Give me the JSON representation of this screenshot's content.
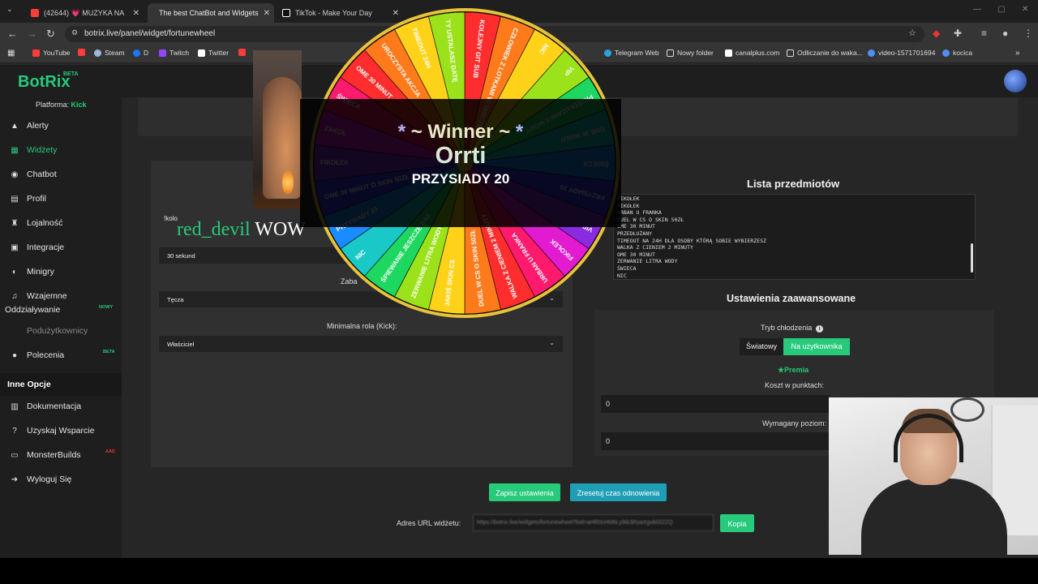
{
  "browser": {
    "tabs": [
      {
        "label": "(42644) 💗 MUZYKA NA",
        "active": false,
        "color": "#ff3b3b"
      },
      {
        "label": "The best ChatBot and Widgets",
        "active": true,
        "color": "#ffffff"
      },
      {
        "label": "TikTok - Make Your Day",
        "active": false,
        "color": "#ffffff"
      }
    ],
    "url": "botrix.live/panel/widget/fortunewheel",
    "bookmarks": [
      {
        "label": "YouTube",
        "color": "#ff3b3b"
      },
      {
        "label": "",
        "color": "#ff3b3b"
      },
      {
        "label": "Steam",
        "color": "#9ab8d8"
      },
      {
        "label": "D",
        "color": "#1877f2"
      },
      {
        "label": "Twitch",
        "color": "#9146ff"
      },
      {
        "label": "Twitter",
        "color": "#ffffff"
      },
      {
        "label": "Telegram Web",
        "color": "#2aa3df"
      },
      {
        "label": "Nowy folder",
        "color": "#dddddd"
      },
      {
        "label": "canalplus.com",
        "color": "#ffffff"
      },
      {
        "label": "Odliczanie do waka...",
        "color": "#dddddd"
      },
      {
        "label": "video-1571701694",
        "color": "#4f8ef7"
      },
      {
        "label": "kocica",
        "color": "#4f8ef7"
      }
    ]
  },
  "app": {
    "logo": "BotRix",
    "logo_badge": "BETA",
    "platform_label": "Platforma:",
    "platform_value": "Kick",
    "nav": [
      {
        "label": "Alerty",
        "icon": "alert-icon",
        "glyph": "▲",
        "state": "normal"
      },
      {
        "label": "Widżety",
        "icon": "widgets-icon",
        "glyph": "▦",
        "state": "active"
      },
      {
        "label": "Chatbot",
        "icon": "chatbot-icon",
        "glyph": "◉",
        "state": "normal"
      },
      {
        "label": "Profil",
        "icon": "profile-icon",
        "glyph": "▤",
        "state": "normal"
      },
      {
        "label": "Lojalność",
        "icon": "trophy-icon",
        "glyph": "♜",
        "state": "normal"
      },
      {
        "label": "Integracje",
        "icon": "integrations-icon",
        "glyph": "▣",
        "state": "normal"
      },
      {
        "label": "Minigry",
        "icon": "gamepad-icon",
        "glyph": "◐",
        "state": "normal"
      },
      {
        "label": "Wzajemne",
        "icon": "music-icon",
        "glyph": "♫",
        "state": "normal"
      },
      {
        "label": "Podużytkownicy",
        "icon": "subusers-icon",
        "glyph": "",
        "state": "disabled"
      },
      {
        "label": "Polecenia",
        "icon": "referrals-icon",
        "glyph": "●",
        "state": "normal"
      }
    ],
    "nav_line2": "Oddziaływanie",
    "badge_new": "NOWY",
    "badge_beta": "BETA",
    "badge_ad": "AAD",
    "other_title": "Inne Opcje",
    "other": [
      {
        "label": "Dokumentacja",
        "icon": "book-icon",
        "glyph": "▥"
      },
      {
        "label": "Uzyskaj Wsparcie",
        "icon": "help-icon",
        "glyph": "?"
      },
      {
        "label": "MonsterBuilds",
        "icon": "monitor-icon",
        "glyph": "▭"
      },
      {
        "label": "Wyloguj Się",
        "icon": "logout-icon",
        "glyph": "➜"
      }
    ]
  },
  "widget_form": {
    "command": "!kolo",
    "duration": "30 sekund",
    "label_zaba": "Zaba",
    "theme": "Tęcza",
    "min_role_label": "Minimalna rola (Kick):",
    "min_role": "Właściciel"
  },
  "items_panel": {
    "title": "Lista przedmiotów",
    "items": [
      "FIKOŁEK",
      "FIKOŁEK",
      "URBAN U FRANKA",
      "DUEL W CS O SKIN 50ZŁ",
      "OME 30 MINUT",
      "PRZEDŁUŻANY",
      "TIMEOUT NA 24H DLA OSOBY KTÓRĄ SOBIE WYBIERZESZ",
      "WALKA Z CIENIEM 2 MINUTY",
      "OME 30 MINUT",
      "ZERWANIE LITRA WODY",
      "ŚWIECA",
      "NIC"
    ]
  },
  "advanced": {
    "title": "Ustawienia zaawansowane",
    "cooldown_label": "Tryb chłodzenia",
    "mode_global": "Światowy",
    "mode_user": "Na użytkownika",
    "premium": "Premia",
    "cost_label": "Koszt w punktach:",
    "cost_value": "0",
    "level_label": "Wymagany poziom:",
    "level_value": "0"
  },
  "actions": {
    "save": "Zapisz ustawienia",
    "reset": "Zresetuj czas odnowienia",
    "url_label": "Adres URL widżetu:",
    "url_value": "https://botrix.live/widgets/fortunewheel?bid=aHR0cHM6Ly9ib3RyaXgubGl2ZQ",
    "copy": "Kopia"
  },
  "overlay": {
    "chat_user": "red_devil",
    "chat_msg": "WOW",
    "winner_title": "~ Winner ~",
    "winner_name": "Orrti",
    "winner_prize": "PRZYSIADY 20",
    "wheel_segments": [
      "KOLEJNY GIT SUB",
      "CZŁOWIEK Z LOTKAMI W TARCZE",
      "NIC",
      "VIP",
      "PRZEDŁUŻANKA WODY",
      "OME 30 MINUT",
      "ŚWIECA",
      "PRZYSIADY 20",
      "VIP",
      "FIKOŁEK",
      "URBAN U FRANKA",
      "WALKA Z CIENIEM 2 MINUTY",
      "DUEL W CS O SKIN 50ZŁ",
      "JAKIŚ SKIN CS",
      "ZERWANIE LITRA WODY",
      "ŚPIEWANIE JESZCZE RAZ",
      "NIC",
      "PRZYSIADY 20",
      "OME 30 MINUT O SKIN 50ZŁ",
      "FIKOŁEK",
      "ZAKOŁ",
      "ŚWIECA",
      "OME 30 MINUT",
      "UROCZYSTA AKCJA",
      "TIMEOUT 24H",
      "TY USTALASZ DATĘ"
    ],
    "wheel_colors": [
      "#ff2d2d",
      "#ff7a1a",
      "#ffd21a",
      "#9be21a",
      "#1ed760",
      "#1ac8c8",
      "#1a8cff",
      "#3a3aff",
      "#8a2be2",
      "#e21ad0",
      "#ff1a6e"
    ]
  }
}
